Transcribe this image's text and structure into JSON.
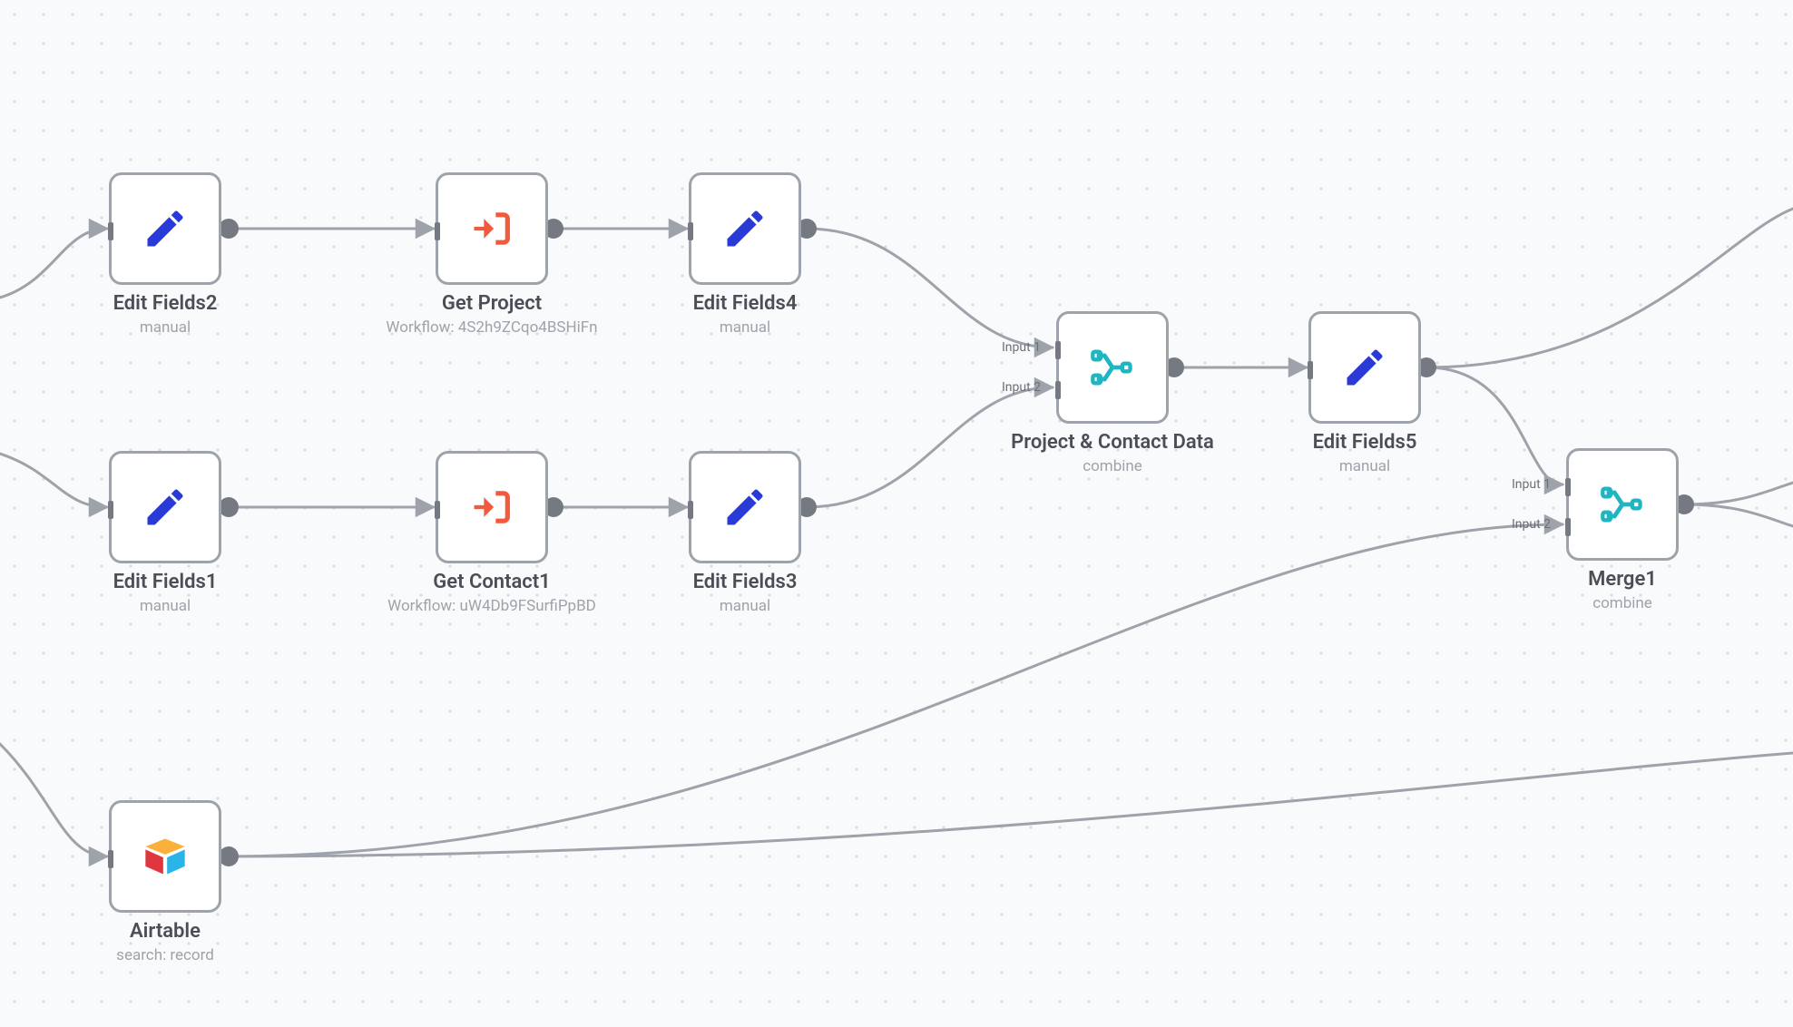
{
  "nodes": {
    "edit_fields_2": {
      "title": "Edit Fields2",
      "sub": "manual"
    },
    "get_project": {
      "title": "Get Project",
      "sub": "Workflow: 4S2h9ZCqo4BSHiFn"
    },
    "edit_fields_4": {
      "title": "Edit Fields4",
      "sub": "manual"
    },
    "edit_fields_1": {
      "title": "Edit Fields1",
      "sub": "manual"
    },
    "get_contact_1": {
      "title": "Get Contact1",
      "sub": "Workflow: uW4Db9FSurfiPpBD"
    },
    "edit_fields_3": {
      "title": "Edit Fields3",
      "sub": "manual"
    },
    "project_contact": {
      "title": "Project & Contact Data",
      "sub": "combine"
    },
    "edit_fields_5": {
      "title": "Edit Fields5",
      "sub": "manual"
    },
    "merge_1": {
      "title": "Merge1",
      "sub": "combine"
    },
    "airtable": {
      "title": "Airtable",
      "sub": "search: record"
    }
  },
  "port_labels": {
    "input1": "Input 1",
    "input2": "Input 2"
  }
}
